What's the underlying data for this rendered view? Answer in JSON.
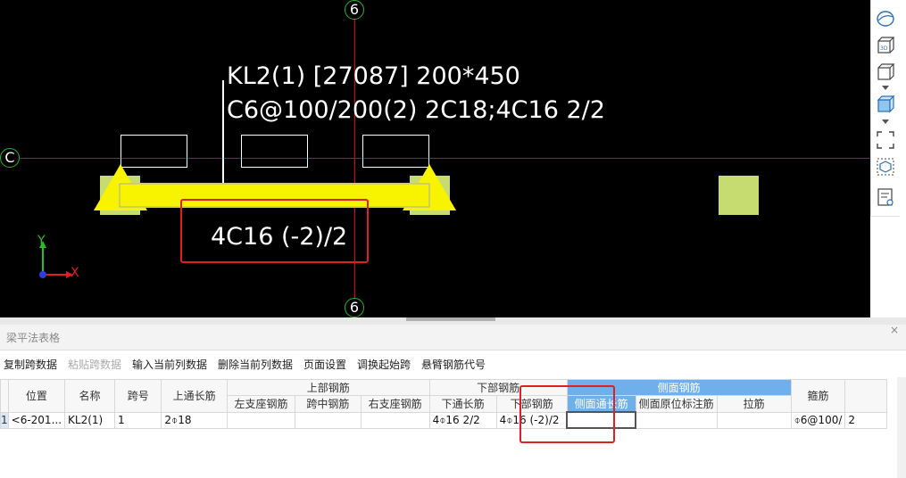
{
  "viewport": {
    "axis_top_label": "6",
    "axis_bottom_label": "6",
    "axis_left_label": "C",
    "beam_annotation_line1": "KL2(1) [27087] 200*450",
    "beam_annotation_line2": "C6@100/200(2) 2C18;4C16 2/2",
    "beam_bottom_annotation": "4C16 (-2)/2",
    "ucs_y": "Y",
    "ucs_x": "X"
  },
  "right_toolbar": {
    "icons": [
      "globe-icon",
      "3d-view-icon",
      "box-view-icon",
      "box-blue-icon",
      "fullscreen-icon",
      "select-box-icon",
      "properties-icon"
    ]
  },
  "panel": {
    "title": "梁平法表格",
    "close": "×",
    "toolbar": {
      "copy_span": "复制跨数据",
      "paste_span": "粘贴跨数据",
      "input_column": "输入当前列数据",
      "delete_column": "删除当前列数据",
      "page_setup": "页面设置",
      "swap_start": "调换起始跨",
      "cantilever_code": "悬臂钢筋代号"
    },
    "table": {
      "headers": {
        "position": "位置",
        "name": "名称",
        "span_no": "跨号",
        "top_through": "上通长筋",
        "top_group": "上部钢筋",
        "left_support": "左支座钢筋",
        "mid_span": "跨中钢筋",
        "right_support": "右支座钢筋",
        "bottom_group": "下部钢筋",
        "bottom_through": "下通长筋",
        "bottom_bar": "下部钢筋",
        "side_group": "侧面钢筋",
        "side_through": "侧面通长筋",
        "side_annot": "侧面原位标注筋",
        "tie": "拉筋",
        "stirrup": "箍筋"
      },
      "row": {
        "row_no": "1",
        "position": "<6-201...",
        "name": "KL2(1)",
        "span_no": "1",
        "top_through": "2⌽18",
        "left_support": "",
        "mid_span": "",
        "right_support": "",
        "bottom_through": "4⌽16 2/2",
        "bottom_bar": "4⌽16 (-2)/2",
        "side_through": "",
        "side_annot": "",
        "tie": "",
        "stirrup": "⌽6@100/",
        "extra": "2"
      }
    }
  },
  "colors": {
    "axis": "#e0000b",
    "beam": "#f8f400",
    "column": "#c6db70",
    "highlight": "#e02020",
    "side_group_header": "#6fb0ea"
  }
}
